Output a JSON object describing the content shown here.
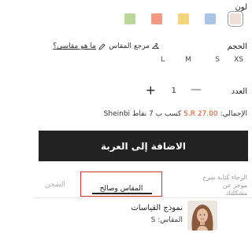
{
  "color": {
    "label": "لون",
    "swatches": [
      {
        "name": "pink",
        "hex": "#f1dcd8",
        "selected": true
      },
      {
        "name": "blue",
        "hex": "#a9c3e2",
        "selected": false
      },
      {
        "name": "yellow",
        "hex": "#f3d57b",
        "selected": false
      },
      {
        "name": "coral",
        "hex": "#f19a84",
        "selected": false
      },
      {
        "name": "green",
        "hex": "#b8d89a",
        "selected": false
      }
    ]
  },
  "size": {
    "label": "الحجم",
    "guide_label": "مرجع المقاس",
    "my_size_label": "ما هو مقاسي؟",
    "options": [
      "XS",
      "S",
      "M",
      "L"
    ]
  },
  "quantity": {
    "label": "العدد",
    "value": "1",
    "minus": "—",
    "plus": "+"
  },
  "total": {
    "label": "الإجمالي:",
    "price": "S.R 27.00",
    "earn_text": "كسب ب  7  نقاط",
    "brand": "Sheinbi"
  },
  "add_to_cart": {
    "label": "الاضافة إلى العربة"
  },
  "tabs": {
    "description": "الرجاء كتابة شرح موجز عن مشكلتك",
    "size_fit": "المقاس وصالح",
    "shipping": "الشحن"
  },
  "model": {
    "title": "نموذج القياسات",
    "size_text": "المقاس: S"
  }
}
